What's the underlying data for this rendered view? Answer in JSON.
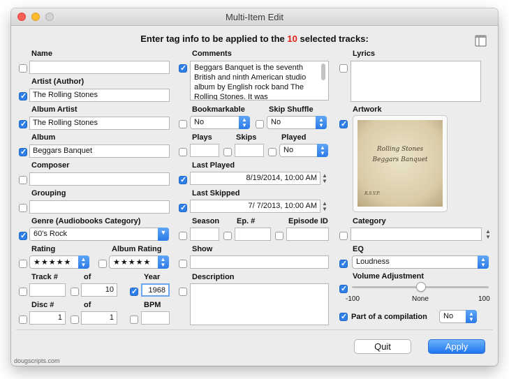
{
  "window": {
    "title": "Multi-Item Edit"
  },
  "header": {
    "prefix": "Enter tag info to be applied to the",
    "count": "10",
    "suffix": "selected tracks:"
  },
  "col1": {
    "name_label": "Name",
    "name_value": "",
    "artist_label": "Artist (Author)",
    "artist_value": "The Rolling Stones",
    "album_artist_label": "Album Artist",
    "album_artist_value": "The Rolling Stones",
    "album_label": "Album",
    "album_value": "Beggars Banquet",
    "composer_label": "Composer",
    "composer_value": "",
    "grouping_label": "Grouping",
    "grouping_value": "",
    "genre_label": "Genre (Audiobooks Category)",
    "genre_value": "60's Rock",
    "rating_label": "Rating",
    "rating_value": "★★★★★",
    "album_rating_label": "Album Rating",
    "album_rating_value": "★★★★★",
    "track_label": "Track #",
    "track_value": "",
    "of_label": "of",
    "track_of_value": "10",
    "year_label": "Year",
    "year_value": "1968",
    "disc_label": "Disc #",
    "disc_value": "1",
    "disc_of_label": "of",
    "disc_of_value": "1",
    "bpm_label": "BPM",
    "bpm_value": ""
  },
  "col2": {
    "comments_label": "Comments",
    "comments_value": "Beggars Banquet is the seventh British and ninth American studio album by English rock band The Rolling Stones. It was",
    "bookmarkable_label": "Bookmarkable",
    "bookmarkable_value": "No",
    "skip_shuffle_label": "Skip Shuffle",
    "skip_shuffle_value": "No",
    "plays_label": "Plays",
    "plays_value": "",
    "skips_label": "Skips",
    "skips_value": "",
    "played_label": "Played",
    "played_value": "No",
    "last_played_label": "Last Played",
    "last_played_value": "8/19/2014, 10:00 AM",
    "last_skipped_label": "Last Skipped",
    "last_skipped_value": "7/  7/2013, 10:00 AM",
    "season_label": "Season",
    "season_value": "",
    "episode_num_label": "Ep. #",
    "episode_num_value": "",
    "episode_id_label": "Episode ID",
    "episode_id_value": "",
    "show_label": "Show",
    "show_value": "",
    "description_label": "Description",
    "description_value": ""
  },
  "col3": {
    "lyrics_label": "Lyrics",
    "lyrics_value": "",
    "artwork_label": "Artwork",
    "artwork_line1": "Rolling Stones",
    "artwork_line2": "Beggars Banquet",
    "artwork_line3": "R.S.V.P.",
    "category_label": "Category",
    "category_value": "",
    "eq_label": "EQ",
    "eq_value": "Loudness",
    "volume_label": "Volume Adjustment",
    "volume_min": "-100",
    "volume_mid": "None",
    "volume_max": "100",
    "volume_fraction": 0.5,
    "compilation_label": "Part of a compilation",
    "compilation_value": "No"
  },
  "footer": {
    "quit_label": "Quit",
    "apply_label": "Apply",
    "credit": "dougscripts.com"
  },
  "colors": {
    "accent": "#2f7fe6",
    "highlight": "#e0201b",
    "window_bg": "#ececec"
  }
}
